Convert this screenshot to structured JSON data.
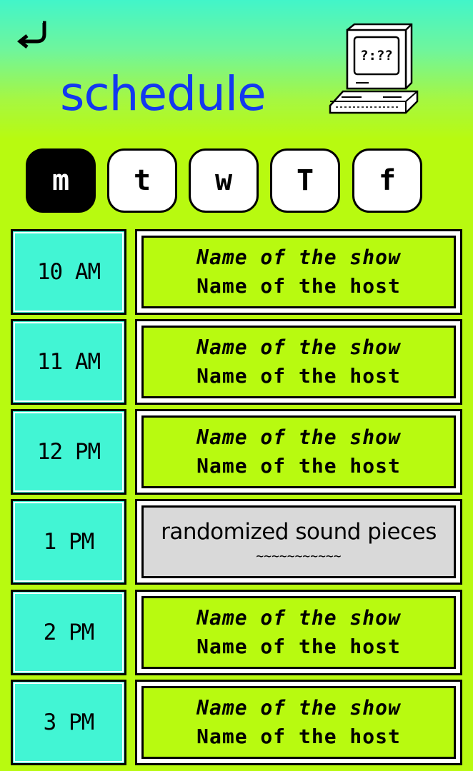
{
  "header": {
    "back_icon": "return-arrow-icon",
    "title": "schedule",
    "computer_screen_text": "?:??",
    "computer_icon": "retro-computer-icon"
  },
  "days": [
    {
      "label": "m",
      "active": true
    },
    {
      "label": "t",
      "active": false
    },
    {
      "label": "w",
      "active": false
    },
    {
      "label": "T",
      "active": false
    },
    {
      "label": "f",
      "active": false
    }
  ],
  "schedule": [
    {
      "time": "10 AM",
      "show": "Name of the show",
      "host": "Name of the host"
    },
    {
      "time": "11 AM",
      "show": "Name of the show",
      "host": "Name of the host"
    },
    {
      "time": "12 PM",
      "show": "Name of the show",
      "host": "Name of the host"
    },
    {
      "time": "1 PM",
      "title": "randomized sound pieces",
      "subtitle": "~~~~~~~~~~~"
    },
    {
      "time": "2 PM",
      "show": "Name of the show",
      "host": "Name of the host"
    },
    {
      "time": "3 PM",
      "show": "Name of the show",
      "host": "Name of the host"
    }
  ],
  "colors": {
    "accent": "#1338f0",
    "time_cell": "#42f5d4",
    "show_cell": "#b8fa10",
    "special_cell": "#d9d9d9"
  }
}
